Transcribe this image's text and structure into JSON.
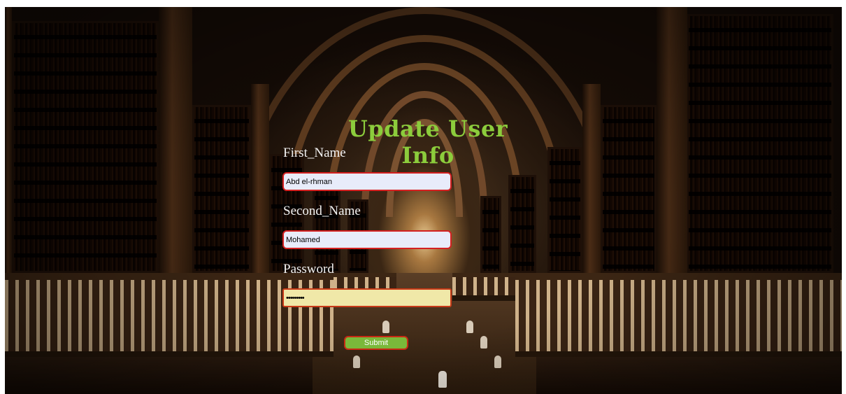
{
  "form": {
    "title": "Update User Info",
    "fields": [
      {
        "label": "First_Name",
        "value": "Abd el-rhman"
      },
      {
        "label": "Second_Name",
        "value": "Mohamed"
      },
      {
        "label": "Password",
        "value": "•••••••••"
      }
    ],
    "submit_label": "Submit"
  },
  "colors": {
    "title": "#8ccc3c",
    "field_border": "#d42020",
    "submit_bg": "#7ab83a"
  }
}
